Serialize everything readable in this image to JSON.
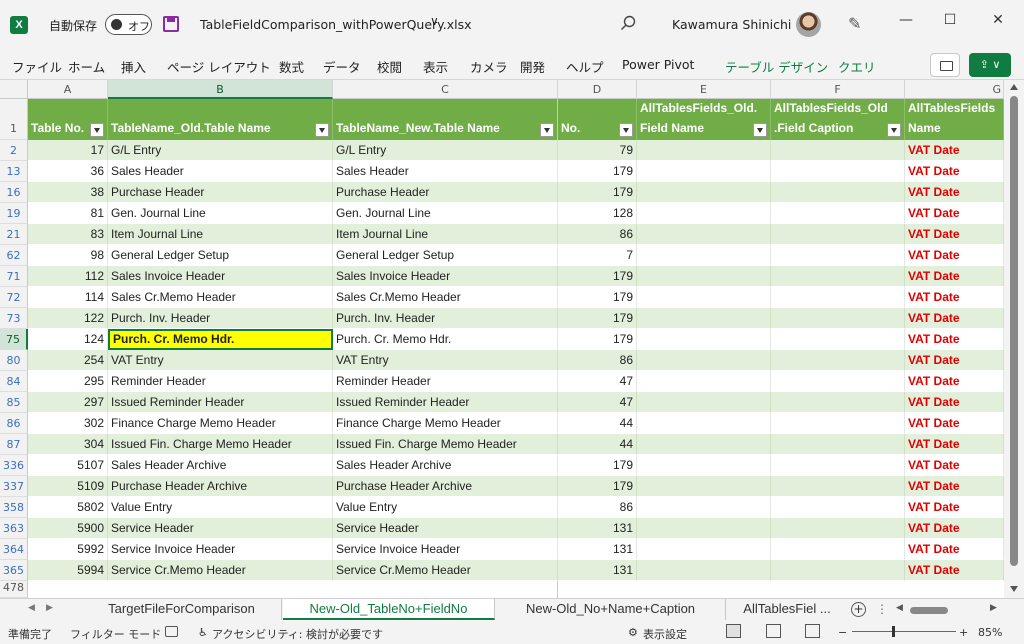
{
  "titlebar": {
    "app_icon": "X",
    "autosave_label": "自動保存",
    "autosave_state": "オフ",
    "filename": "TableFieldComparison_withPowerQuery.xlsx",
    "dropdown_glyph": "∨",
    "user_name": "Kawamura Shinichi",
    "minimize": "—",
    "maximize": "☐",
    "close": "✕"
  },
  "ribbon": {
    "tabs": [
      "ファイル",
      "ホーム",
      "挿入",
      "ページ レイアウト",
      "数式",
      "データ",
      "校閲",
      "表示",
      "カメラ",
      "開発",
      "ヘルプ",
      "Power Pivot",
      "テーブル デザイン",
      "クエリ"
    ],
    "share_glyph": "⇪ ∨"
  },
  "grid": {
    "column_letters": [
      "A",
      "B",
      "C",
      "D",
      "E",
      "F",
      "G"
    ],
    "header_row_number": "1",
    "headers": [
      {
        "line1": "",
        "line2": "Table No."
      },
      {
        "line1": "",
        "line2": "TableName_Old.Table Name"
      },
      {
        "line1": "",
        "line2": "TableName_New.Table Name"
      },
      {
        "line1": "",
        "line2": "No."
      },
      {
        "line1": "AllTablesFields_Old.",
        "line2": "Field Name"
      },
      {
        "line1": "AllTablesFields_Old",
        "line2": ".Field Caption"
      },
      {
        "line1": "AllTablesFields",
        "line2": "Name"
      }
    ],
    "rows": [
      {
        "rn": "2",
        "a": "17",
        "b": "G/L Entry",
        "c": "G/L Entry",
        "d": "79",
        "g": "VAT Date"
      },
      {
        "rn": "13",
        "a": "36",
        "b": "Sales Header",
        "c": "Sales Header",
        "d": "179",
        "g": "VAT Date"
      },
      {
        "rn": "16",
        "a": "38",
        "b": "Purchase Header",
        "c": "Purchase Header",
        "d": "179",
        "g": "VAT Date"
      },
      {
        "rn": "19",
        "a": "81",
        "b": "Gen. Journal Line",
        "c": "Gen. Journal Line",
        "d": "128",
        "g": "VAT Date"
      },
      {
        "rn": "21",
        "a": "83",
        "b": "Item Journal Line",
        "c": "Item Journal Line",
        "d": "86",
        "g": "VAT Date"
      },
      {
        "rn": "62",
        "a": "98",
        "b": "General Ledger Setup",
        "c": "General Ledger Setup",
        "d": "7",
        "g": "VAT Date"
      },
      {
        "rn": "71",
        "a": "112",
        "b": "Sales Invoice Header",
        "c": "Sales Invoice Header",
        "d": "179",
        "g": "VAT Date"
      },
      {
        "rn": "72",
        "a": "114",
        "b": "Sales Cr.Memo Header",
        "c": "Sales Cr.Memo Header",
        "d": "179",
        "g": "VAT Date"
      },
      {
        "rn": "73",
        "a": "122",
        "b": "Purch. Inv. Header",
        "c": "Purch. Inv. Header",
        "d": "179",
        "g": "VAT Date"
      },
      {
        "rn": "75",
        "a": "124",
        "b": "Purch. Cr. Memo Hdr.",
        "c": "Purch. Cr. Memo Hdr.",
        "d": "179",
        "g": "VAT Date"
      },
      {
        "rn": "80",
        "a": "254",
        "b": "VAT Entry",
        "c": "VAT Entry",
        "d": "86",
        "g": "VAT Date"
      },
      {
        "rn": "84",
        "a": "295",
        "b": "Reminder Header",
        "c": "Reminder Header",
        "d": "47",
        "g": "VAT Date"
      },
      {
        "rn": "85",
        "a": "297",
        "b": "Issued Reminder Header",
        "c": "Issued Reminder Header",
        "d": "47",
        "g": "VAT Date"
      },
      {
        "rn": "86",
        "a": "302",
        "b": "Finance Charge Memo Header",
        "c": "Finance Charge Memo Header",
        "d": "44",
        "g": "VAT Date"
      },
      {
        "rn": "87",
        "a": "304",
        "b": "Issued Fin. Charge Memo Header",
        "c": "Issued Fin. Charge Memo Header",
        "d": "44",
        "g": "VAT Date"
      },
      {
        "rn": "336",
        "a": "5107",
        "b": "Sales Header Archive",
        "c": "Sales Header Archive",
        "d": "179",
        "g": "VAT Date"
      },
      {
        "rn": "337",
        "a": "5109",
        "b": "Purchase Header Archive",
        "c": "Purchase Header Archive",
        "d": "179",
        "g": "VAT Date"
      },
      {
        "rn": "358",
        "a": "5802",
        "b": "Value Entry",
        "c": "Value Entry",
        "d": "86",
        "g": "VAT Date"
      },
      {
        "rn": "363",
        "a": "5900",
        "b": "Service Header",
        "c": "Service Header",
        "d": "131",
        "g": "VAT Date"
      },
      {
        "rn": "364",
        "a": "5992",
        "b": "Service Invoice Header",
        "c": "Service Invoice Header",
        "d": "131",
        "g": "VAT Date"
      },
      {
        "rn": "365",
        "a": "5994",
        "b": "Service Cr.Memo Header",
        "c": "Service Cr.Memo Header",
        "d": "131",
        "g": "VAT Date"
      }
    ],
    "last_row_number": "478",
    "selected_row_number": "75",
    "selected_column": "B"
  },
  "sheets": {
    "tabs": [
      "TargetFileForComparison",
      "New-Old_TableNo+FieldNo",
      "New-Old_No+Name+Caption",
      "AllTablesFiel ..."
    ],
    "active_index": 1,
    "add_glyph": "+",
    "more_glyph": "⋮"
  },
  "statusbar": {
    "ready": "準備完了",
    "filter_mode": "フィルター モード",
    "accessibility": "アクセシビリティ: 検討が必要です",
    "display_settings": "表示設定",
    "zoom_minus": "−",
    "zoom_plus": "+",
    "zoom": "85%"
  },
  "colors": {
    "excel_green": "#107c41",
    "table_header": "#70ad47",
    "band": "#e2efda",
    "highlight": "#ffff00",
    "red_text": "#e00000"
  }
}
